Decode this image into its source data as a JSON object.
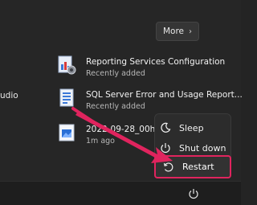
{
  "header": {
    "more_label": "More",
    "more_icon": "chevron-right-icon"
  },
  "left_partial_text": "udio",
  "recommended": [
    {
      "title": "Reporting Services Configuration",
      "subtitle": "Recently added",
      "icon": "report-config-icon"
    },
    {
      "title": "SQL Server Error and Usage Report...",
      "subtitle": "Recently added",
      "icon": "document-icon"
    },
    {
      "title": "2022-09-28_00h29_2...",
      "subtitle": "1m ago",
      "icon": "image-file-icon"
    }
  ],
  "power_menu": {
    "items": [
      {
        "label": "Sleep",
        "icon": "moon-icon"
      },
      {
        "label": "Shut down",
        "icon": "power-icon"
      },
      {
        "label": "Restart",
        "icon": "restart-icon"
      }
    ]
  },
  "footer": {
    "power_icon": "power-icon"
  },
  "annotation": {
    "arrow_color": "#e0245e",
    "highlight_color": "#e0245e"
  }
}
